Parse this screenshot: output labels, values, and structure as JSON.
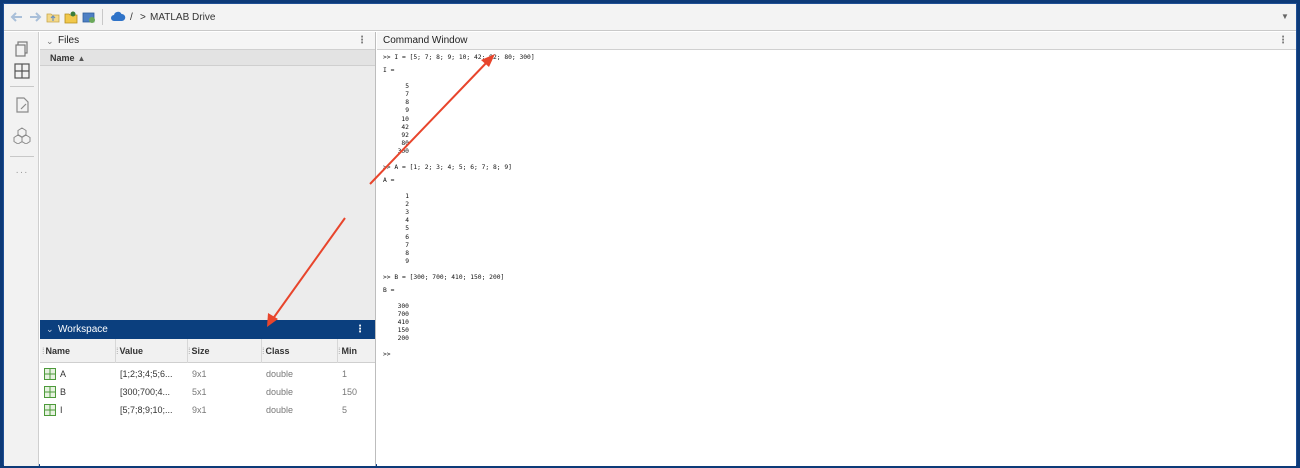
{
  "address_bar": {
    "sep1": "/",
    "sep2": ">",
    "location": "MATLAB Drive"
  },
  "toolstrip": {
    "more": "···"
  },
  "files_panel": {
    "title": "Files",
    "column_name": "Name",
    "sort_indicator": "▲"
  },
  "workspace_panel": {
    "title": "Workspace",
    "columns": [
      "Name",
      "Value",
      "Size",
      "Class",
      "Min"
    ],
    "rows": [
      {
        "name": "A",
        "value": "[1;2;3;4;5;6...",
        "size": "9x1",
        "class": "double",
        "min": "1"
      },
      {
        "name": "B",
        "value": "[300;700;4...",
        "size": "5x1",
        "class": "double",
        "min": "150"
      },
      {
        "name": "I",
        "value": "[5;7;8;9;10;...",
        "size": "9x1",
        "class": "double",
        "min": "5"
      }
    ]
  },
  "command_window": {
    "title": "Command Window",
    "lines": [
      ">> I = [5; 7; 8; 9; 10; 42; 92; 80; 300]",
      "I =",
      "5",
      "7",
      "8",
      "9",
      "10",
      "42",
      "92",
      "80",
      "300",
      ">> A = [1; 2; 3; 4; 5; 6; 7; 8; 9]",
      "A =",
      "1",
      "2",
      "3",
      "4",
      "5",
      "6",
      "7",
      "8",
      "9",
      ">> B = [300; 700; 410; 150; 200]",
      "B =",
      "300",
      "700",
      "410",
      "150",
      "200",
      ">>"
    ]
  },
  "colors": {
    "accent": "#0b3f7e",
    "annotation_arrow": "#e8452c"
  }
}
